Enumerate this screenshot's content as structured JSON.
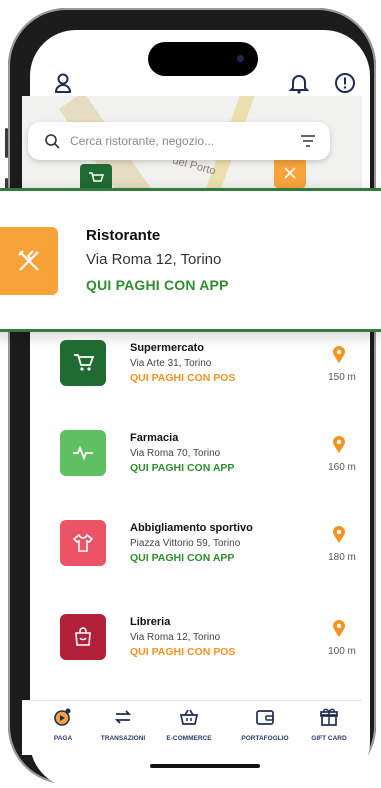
{
  "header": {
    "icons": [
      "user-icon",
      "bell-icon",
      "alert-icon"
    ]
  },
  "search": {
    "placeholder": "Cerca ristorante, negozio..."
  },
  "map": {
    "street_label": "del Porto"
  },
  "selected": {
    "title": "Ristorante",
    "address": "Via Roma 12, Torino",
    "cta": "QUI PAGHI CON APP",
    "color": "#f7a339"
  },
  "list": [
    {
      "name": "Supermercato",
      "address": "Via Arte 31, Torino",
      "cta": "QUI PAGHI CON POS",
      "cta_color": "#f39321",
      "thumb_color": "#1f6b32",
      "icon": "cart-icon",
      "distance": "150 m"
    },
    {
      "name": "Farmacia",
      "address": "Via Roma 70, Torino",
      "cta": "QUI PAGHI CON APP",
      "cta_color": "#2f8d2f",
      "thumb_color": "#5fbf62",
      "icon": "pulse-icon",
      "distance": "160 m"
    },
    {
      "name": "Abbigliamento sportivo",
      "address": "Piazza Vittorio 59, Torino",
      "cta": "QUI PAGHI CON APP",
      "cta_color": "#2f8d2f",
      "thumb_color": "#ec5367",
      "icon": "shirt-icon",
      "distance": "180 m"
    },
    {
      "name": "Libreria",
      "address": "Via Roma 12, Torino",
      "cta": "QUI PAGHI CON POS",
      "cta_color": "#f39321",
      "thumb_color": "#b3203a",
      "icon": "bag-icon",
      "distance": "100 m"
    }
  ],
  "tabs": [
    {
      "label": "PAGA",
      "icon": "pay-icon"
    },
    {
      "label": "TRANSAZIONI",
      "icon": "transfer-icon"
    },
    {
      "label": "E-COMMERCE",
      "icon": "basket-icon"
    },
    {
      "label": "PORTAFOGLIO",
      "icon": "wallet-icon"
    },
    {
      "label": "GIFT CARD",
      "icon": "gift-icon"
    }
  ]
}
